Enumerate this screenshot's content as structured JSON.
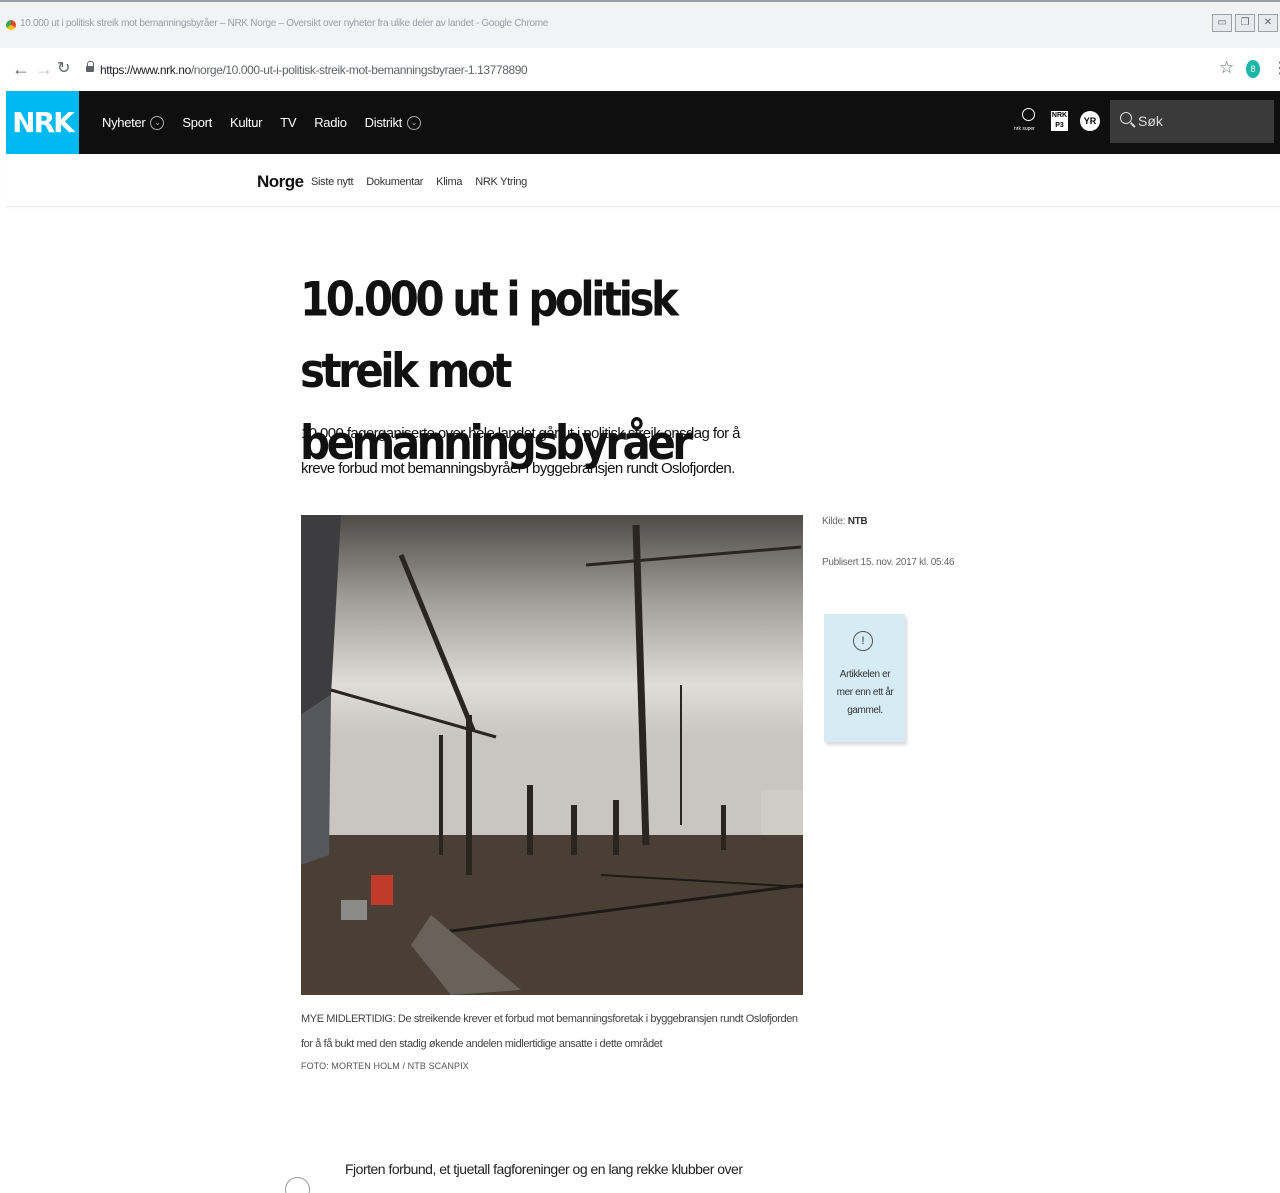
{
  "browser": {
    "window_title": "10.000 ut i politisk streik mot bemanningsbyråer – NRK Norge – Oversikt over nyheter fra ulike deler av landet - Google Chrome",
    "url_domain": "https://www.nrk.no",
    "url_path": "/norge/10.000-ut-i-politisk-streik-mot-bemanningsbyraer-1.13778890",
    "back_icon": "arrow-left-icon",
    "forward_icon": "arrow-right-icon",
    "reload_icon": "reload-icon",
    "extension_badge": "8"
  },
  "site": {
    "logo": "NRK",
    "nav": [
      "Nyheter",
      "Sport",
      "Kultur",
      "TV",
      "Radio",
      "Distrikt"
    ],
    "tools": {
      "super": "nrk super",
      "p3": "NRK P3",
      "yr": "YR"
    },
    "search_placeholder": "Søk",
    "section": "Norge",
    "subnav": [
      "Siste nytt",
      "Dokumentar",
      "Klima",
      "NRK Ytring"
    ],
    "accent": "#00b9f2"
  },
  "article": {
    "headline": "10.000 ut i politisk streik mot bemanningsbyråer",
    "lead": "10.000 fagorganiserte over hele landet går ut i politisk streik onsdag for å kreve forbud mot bemanningsbyråer i byggebransjen rundt Oslofjorden.",
    "caption": "MYE MIDLERTIDIG: De streikende krever et forbud mot bemanningsforetak i byggebransjen rundt Oslofjorden for å få bukt med den stadig økende andelen midlertidige ansatte i dette området",
    "credit": "FOTO: MORTEN HOLM / NTB SCANPIX",
    "source_label": "Kilde:",
    "source_value": "NTB",
    "published": "Publisert 15. nov. 2017 kl. 05:46",
    "age_notice": "Artikkelen er mer enn ett år gammel.",
    "body_start": "Fjorten forbund, et tjuetall fagforeninger og en lang rekke klubber over"
  }
}
